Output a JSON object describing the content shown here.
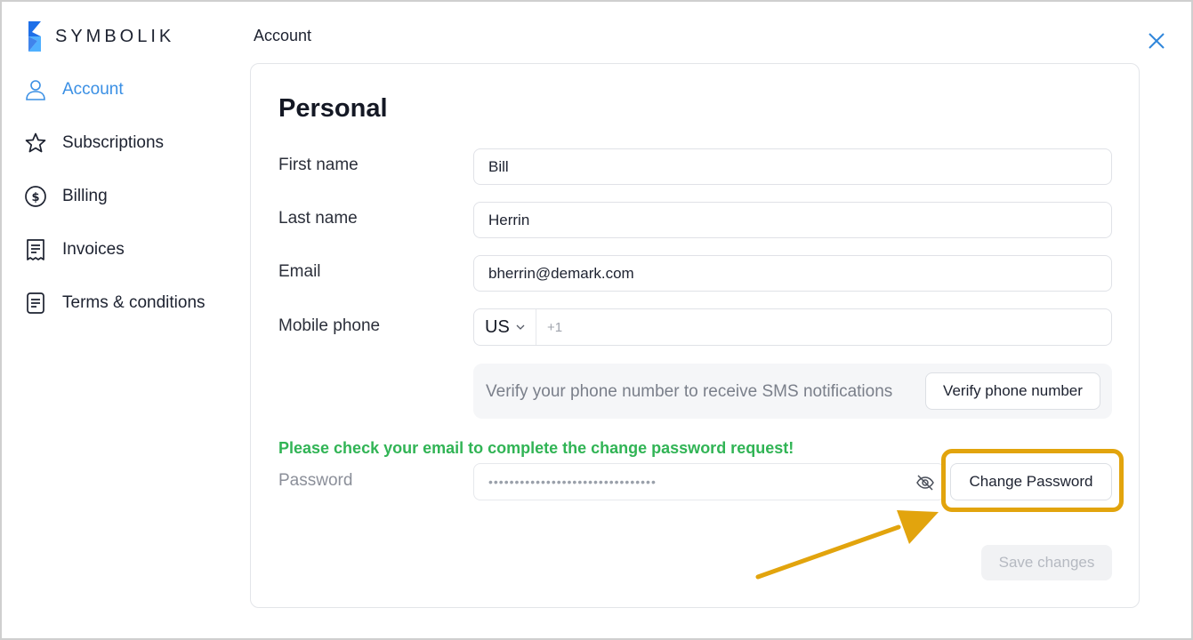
{
  "brand": {
    "name": "SYMBOLIK",
    "logo_colors": [
      "#1e6fe8",
      "#4fb0ff"
    ]
  },
  "header": {
    "title": "Account",
    "close_icon": "close-icon"
  },
  "sidebar": {
    "items": [
      {
        "label": "Account",
        "icon": "user-icon",
        "active": true
      },
      {
        "label": "Subscriptions",
        "icon": "star-icon",
        "active": false
      },
      {
        "label": "Billing",
        "icon": "dollar-circle-icon",
        "active": false
      },
      {
        "label": "Invoices",
        "icon": "receipt-icon",
        "active": false
      },
      {
        "label": "Terms & conditions",
        "icon": "document-icon",
        "active": false
      }
    ]
  },
  "form": {
    "section_title": "Personal",
    "first_name": {
      "label": "First name",
      "value": "Bill"
    },
    "last_name": {
      "label": "Last name",
      "value": "Herrin"
    },
    "email": {
      "label": "Email",
      "value": "bherrin@demark.com"
    },
    "mobile_phone": {
      "label": "Mobile phone",
      "country_code": "US",
      "prefix": "+1"
    },
    "verify": {
      "text": "Verify your phone number to receive SMS notifications",
      "button": "Verify phone number"
    },
    "success_message": "Please check your email to complete the change password request!",
    "password": {
      "label": "Password",
      "value": "••••••••••••••••••••••••••••••••",
      "change_button": "Change Password"
    },
    "save_button": "Save changes"
  },
  "colors": {
    "accent": "#3a8fe4",
    "success": "#31b455",
    "highlight": "#e2a40d"
  }
}
